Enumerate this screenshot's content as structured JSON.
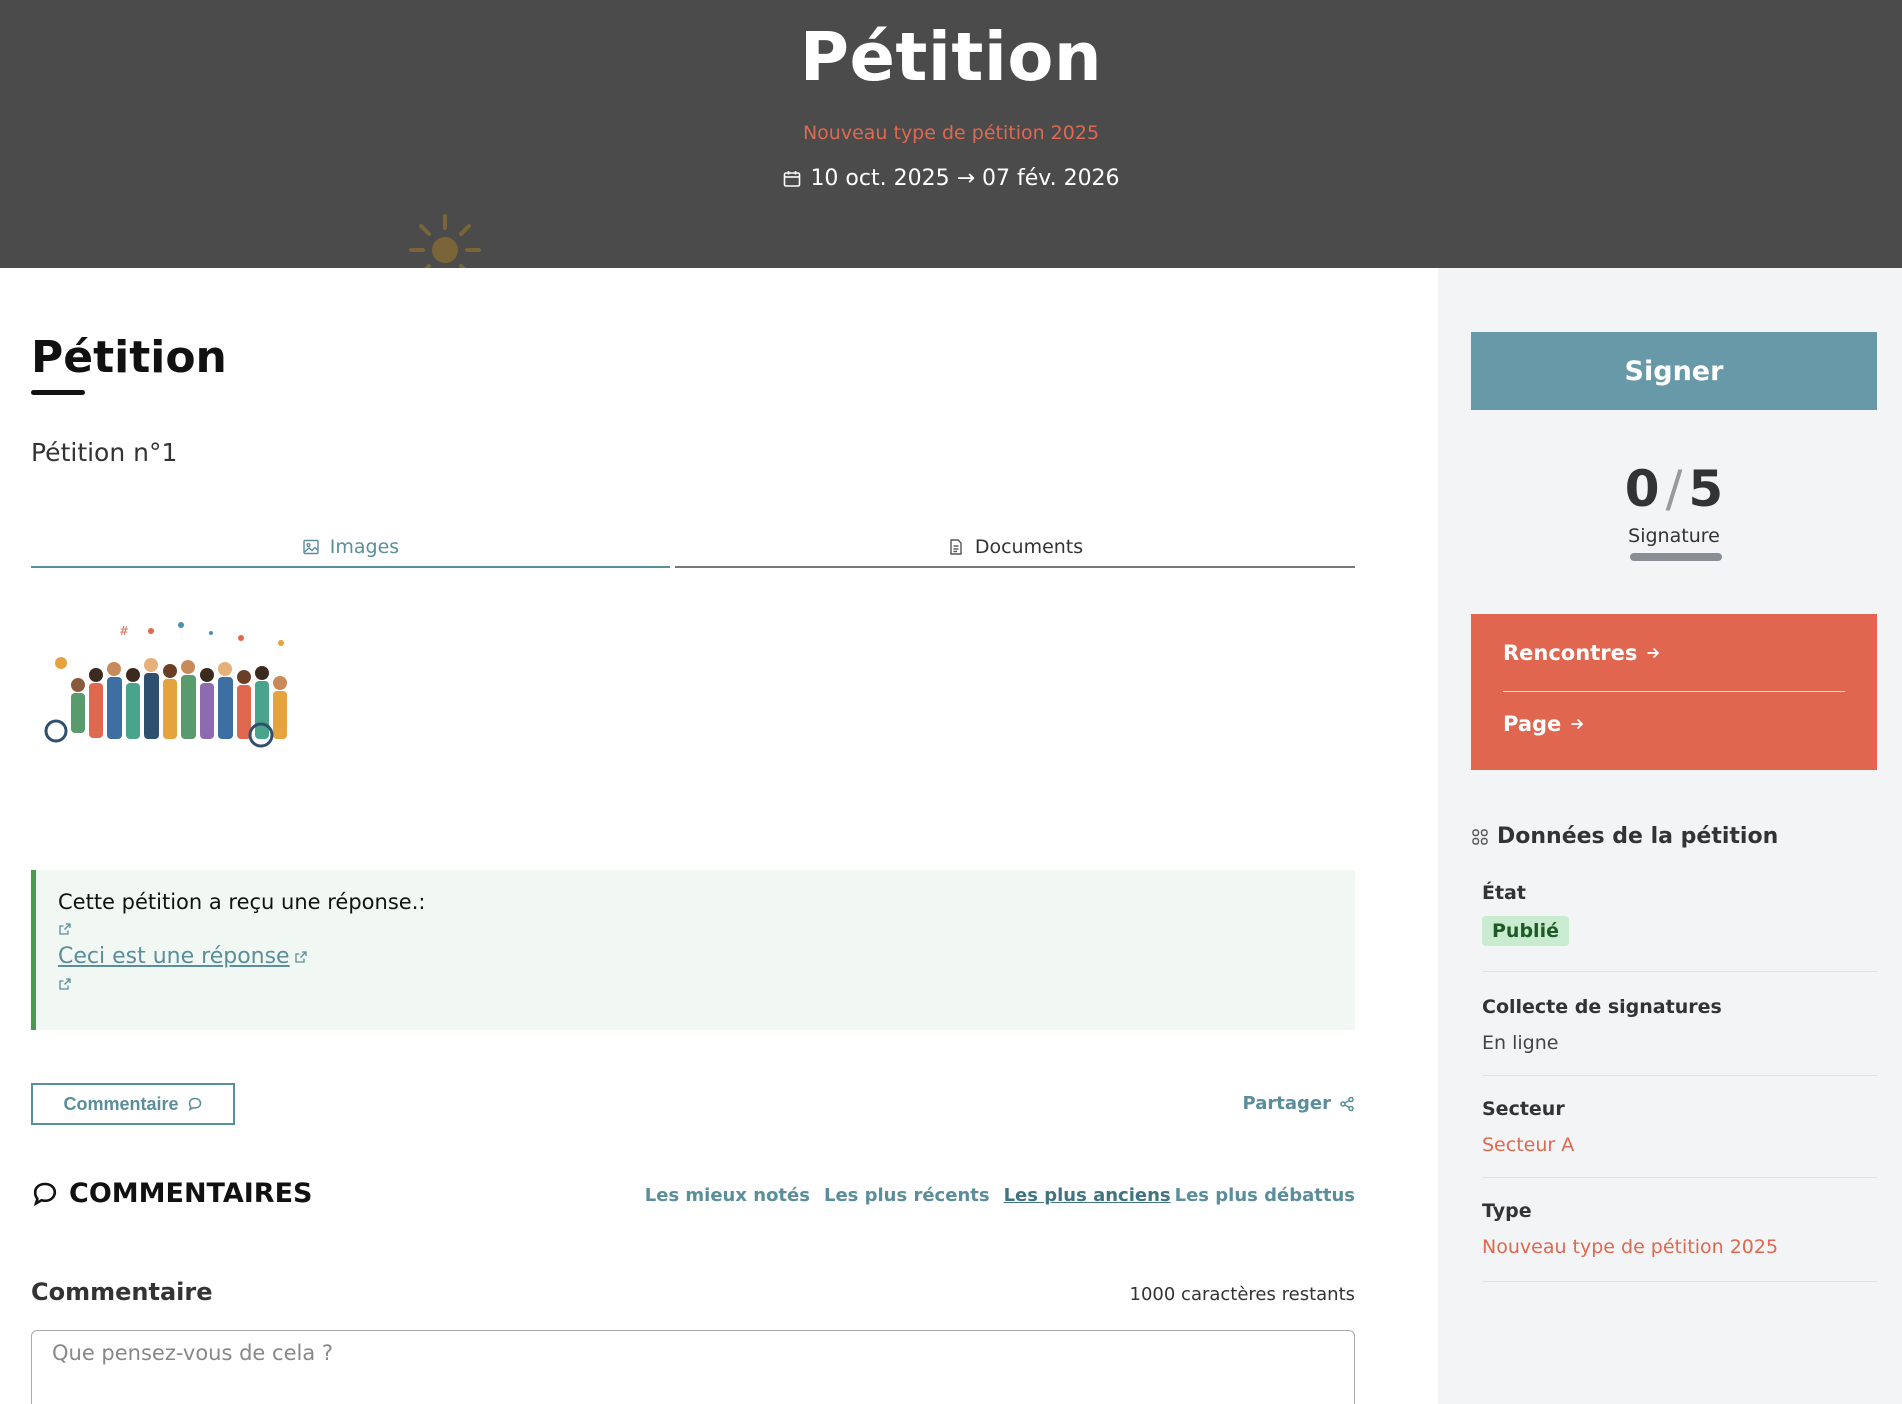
{
  "hero": {
    "title": "Pétition",
    "subtitle": "Nouveau type de pétition 2025",
    "dates": "10 oct. 2025 → 07 fév. 2026"
  },
  "main": {
    "title": "Pétition",
    "description": "Pétition n°1",
    "tabs": [
      {
        "label": "Images",
        "icon": "image-icon",
        "active": true
      },
      {
        "label": "Documents",
        "icon": "document-icon",
        "active": false
      }
    ],
    "response": {
      "title": "Cette pétition a reçu une réponse.:",
      "link_label": "Ceci est une réponse"
    },
    "comment_button": "Commentaire",
    "share_label": "Partager",
    "comments_heading": "COMMENTAIRES",
    "sort_options": [
      {
        "label": "Les mieux notés",
        "active": false
      },
      {
        "label": "Les plus récents",
        "active": false
      },
      {
        "label": "Les plus anciens",
        "active": true
      },
      {
        "label": "Les plus débattus",
        "active": false
      }
    ],
    "comment_form": {
      "label": "Commentaire",
      "chars_left": "1000 caractères restants",
      "placeholder": "Que pensez-vous de cela ?"
    }
  },
  "sidebar": {
    "sign_button": "Signer",
    "count": "0",
    "target": "5",
    "count_label": "Signature",
    "links": [
      "Rencontres",
      "Page"
    ],
    "data_title": "Données de la pétition",
    "data": [
      {
        "label": "État",
        "value": "Publié",
        "kind": "badge"
      },
      {
        "label": "Collecte de signatures",
        "value": "En ligne",
        "kind": "text"
      },
      {
        "label": "Secteur",
        "value": "Secteur A",
        "kind": "link"
      },
      {
        "label": "Type",
        "value": "Nouveau type de pétition 2025",
        "kind": "link"
      }
    ]
  },
  "colors": {
    "accent_teal": "#5a8e9b",
    "sign_button": "#6899a8",
    "orange": "#e06650",
    "hero_bg": "#4b4b4b",
    "success_border": "#4a9a4f"
  }
}
